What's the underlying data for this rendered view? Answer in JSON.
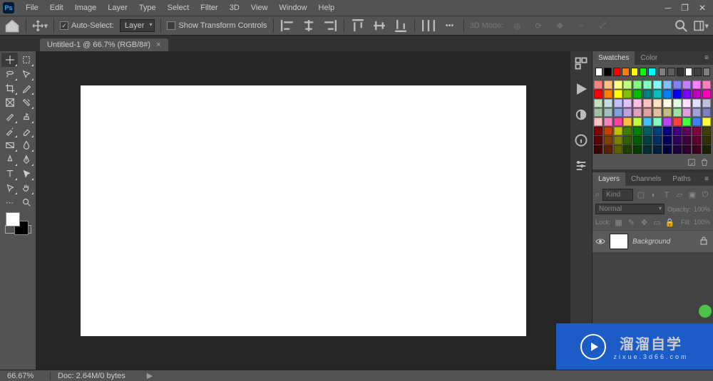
{
  "menu": [
    "File",
    "Edit",
    "Image",
    "Layer",
    "Type",
    "Select",
    "Filter",
    "3D",
    "View",
    "Window",
    "Help"
  ],
  "options": {
    "auto_select_label": "Auto-Select:",
    "auto_select_value": "Layer",
    "show_transform": "Show Transform Controls",
    "mode3d": "3D Mode:"
  },
  "document": {
    "tab": "Untitled-1 @ 66.7% (RGB/8#)"
  },
  "panels": {
    "swatches": "Swatches",
    "color": "Color",
    "layers": "Layers",
    "channels": "Channels",
    "paths": "Paths"
  },
  "swatch_row1": [
    "#ffffff",
    "#000000",
    "#ff0000",
    "#ff8000",
    "#ffff00",
    "#00ff00",
    "#00ffff",
    "#808080",
    "#606060",
    "#303030",
    "#ffffff",
    "#404040",
    "#808080"
  ],
  "swatch_grid": [
    "#ff8080",
    "#ffc080",
    "#ffff80",
    "#c0ff80",
    "#80ff80",
    "#80ffc0",
    "#80ffff",
    "#80c0ff",
    "#8080ff",
    "#c080ff",
    "#ff80ff",
    "#ff80c0",
    "#ff0000",
    "#ff8000",
    "#ffff00",
    "#80c000",
    "#00c000",
    "#008080",
    "#00c0c0",
    "#0080ff",
    "#0000ff",
    "#8000ff",
    "#c000c0",
    "#ff00c0",
    "#c0e0c0",
    "#c0e0e0",
    "#c0c0ff",
    "#e0c0ff",
    "#ffc0e0",
    "#ffc0c0",
    "#ffe0c0",
    "#ffffe0",
    "#e0ffe0",
    "#ffe0ff",
    "#e0e0ff",
    "#c0c0e0",
    "#a0c0a0",
    "#a0c0c0",
    "#80a0e0",
    "#c0a0e0",
    "#e0a0c0",
    "#e0a0a0",
    "#e0c0a0",
    "#c0c080",
    "#a0e0a0",
    "#e0a0e0",
    "#a0a0e0",
    "#8080c0",
    "#ffc0c0",
    "#ff80c0",
    "#ff40a0",
    "#ffc040",
    "#c0ff40",
    "#40c0ff",
    "#80ffc0",
    "#c040ff",
    "#ff4040",
    "#40ff40",
    "#4080ff",
    "#ffff40",
    "#800000",
    "#c04000",
    "#c0c000",
    "#408000",
    "#008000",
    "#006060",
    "#004080",
    "#000080",
    "#400080",
    "#600060",
    "#800040",
    "#404000",
    "#600000",
    "#804000",
    "#808000",
    "#306000",
    "#006000",
    "#004040",
    "#003060",
    "#000060",
    "#300060",
    "#400040",
    "#600030",
    "#303000",
    "#400000",
    "#602000",
    "#606000",
    "#204000",
    "#004000",
    "#003030",
    "#002040",
    "#000040",
    "#200040",
    "#300030",
    "#400020",
    "#202000"
  ],
  "layers": {
    "kind_placeholder": "Kind",
    "blend": "Normal",
    "opacity_label": "Opacity:",
    "opacity_value": "100%",
    "lock_label": "Lock:",
    "fill_label": "Fill:",
    "fill_value": "100%",
    "background": "Background"
  },
  "status": {
    "zoom": "66.67%",
    "doc": "Doc: 2.64M/0 bytes"
  },
  "overlay": {
    "big": "溜溜自学",
    "small": "zixue.3d66.com"
  }
}
